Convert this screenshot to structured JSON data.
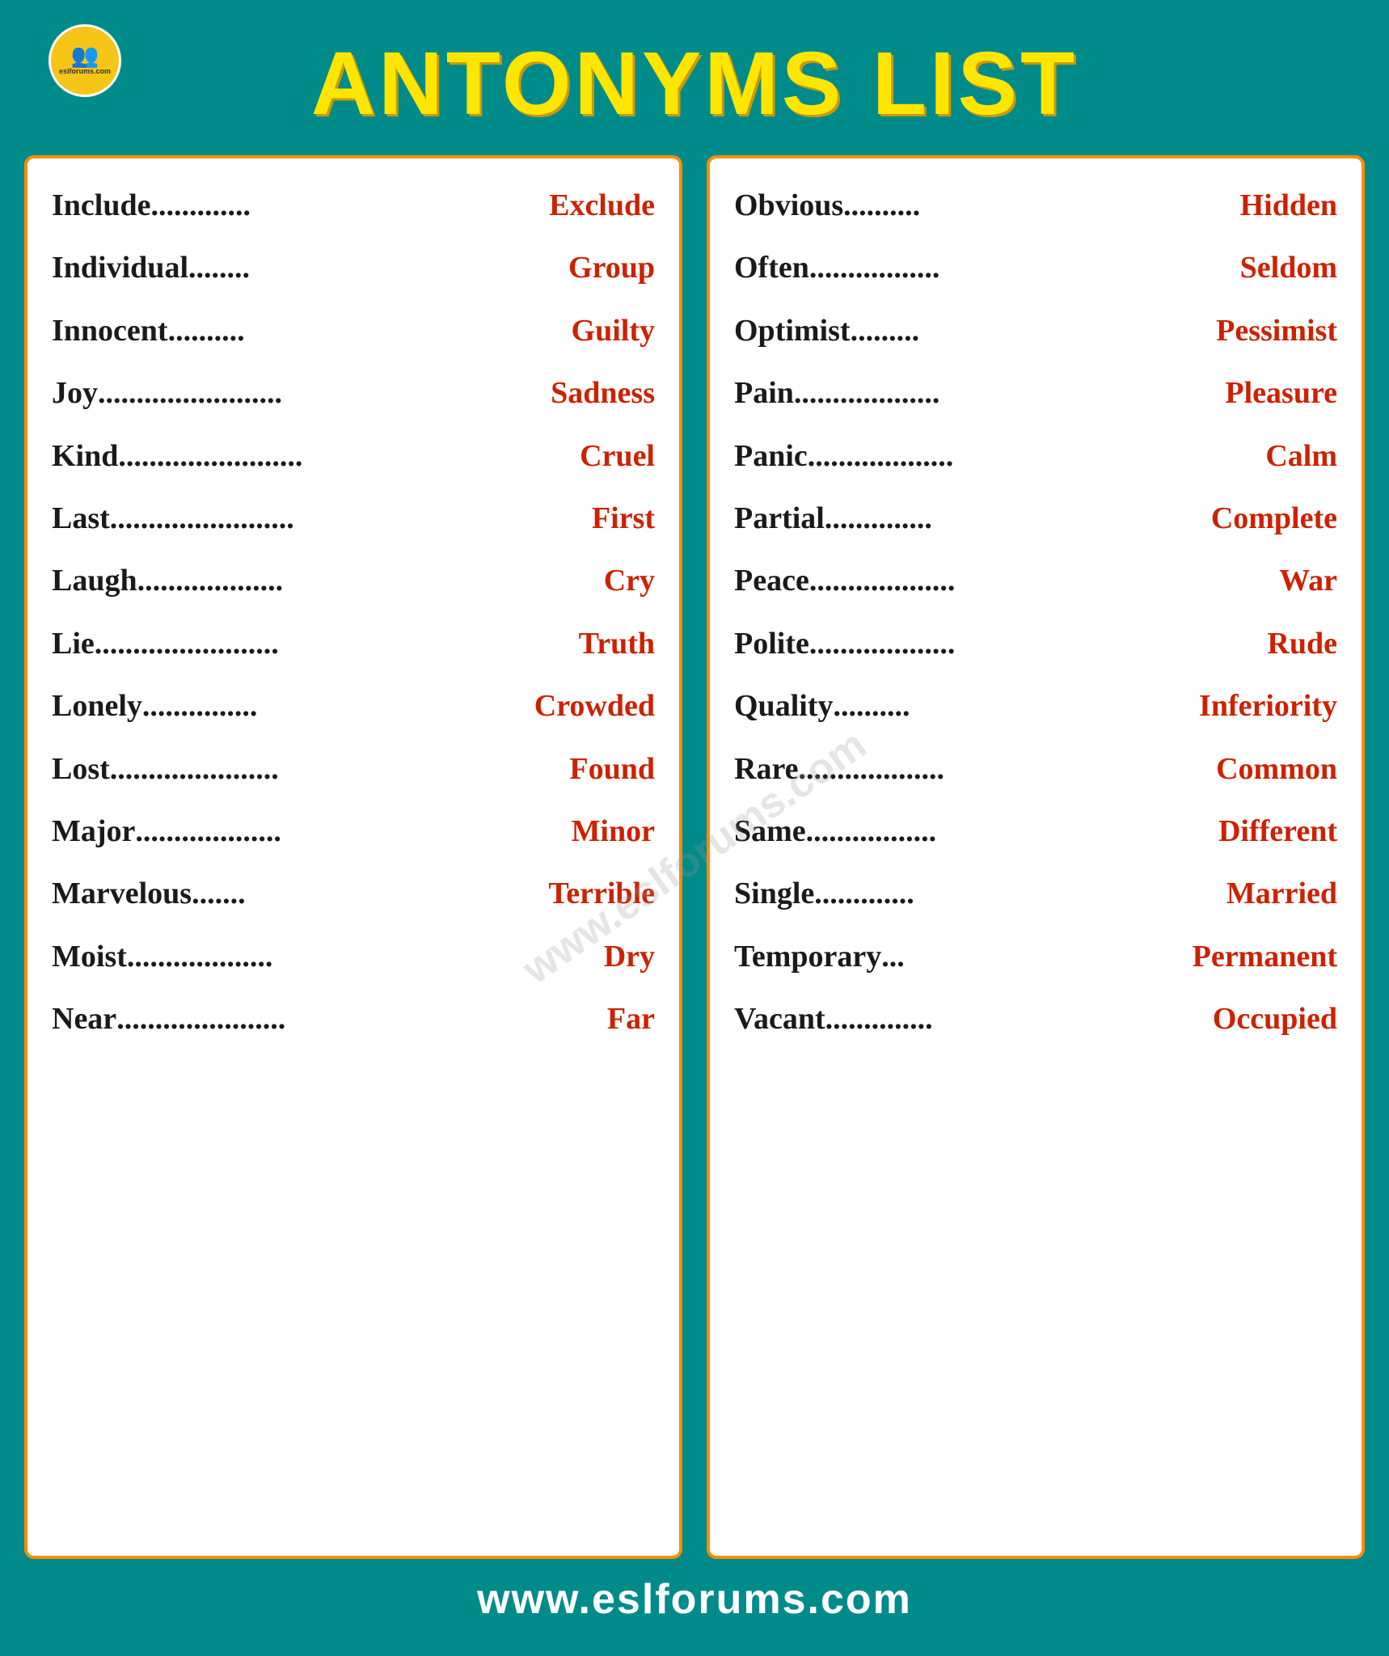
{
  "header": {
    "title": "ANTONYMS LIST",
    "logo_text": "eslforums.com"
  },
  "footer": {
    "url": "www.eslforums.com"
  },
  "watermark": "www.eslforums.com",
  "left_column": [
    {
      "word": "Include",
      "dots": ".............",
      "antonym": "Exclude"
    },
    {
      "word": "Individual",
      "dots": "........",
      "antonym": "Group"
    },
    {
      "word": "Innocent",
      "dots": "..........",
      "antonym": "Guilty"
    },
    {
      "word": "Joy",
      "dots": "........................",
      "antonym": "Sadness"
    },
    {
      "word": "Kind",
      "dots": "........................",
      "antonym": "Cruel"
    },
    {
      "word": "Last",
      "dots": "........................",
      "antonym": "First"
    },
    {
      "word": "Laugh",
      "dots": "...................",
      "antonym": "Cry"
    },
    {
      "word": "Lie",
      "dots": "........................",
      "antonym": "Truth"
    },
    {
      "word": "Lonely",
      "dots": "...............",
      "antonym": "Crowded"
    },
    {
      "word": "Lost",
      "dots": "......................",
      "antonym": "Found"
    },
    {
      "word": "Major",
      "dots": "...................",
      "antonym": "Minor"
    },
    {
      "word": "Marvelous",
      "dots": ".......",
      "antonym": "Terrible"
    },
    {
      "word": "Moist",
      "dots": "...................",
      "antonym": "Dry"
    },
    {
      "word": "Near",
      "dots": "......................",
      "antonym": "Far"
    }
  ],
  "right_column": [
    {
      "word": "Obvious",
      "dots": "..........",
      "antonym": "Hidden"
    },
    {
      "word": "Often",
      "dots": ".................",
      "antonym": "Seldom"
    },
    {
      "word": "Optimist",
      "dots": ".........",
      "antonym": "Pessimist"
    },
    {
      "word": "Pain",
      "dots": "...................",
      "antonym": "Pleasure"
    },
    {
      "word": "Panic",
      "dots": "...................",
      "antonym": "Calm"
    },
    {
      "word": "Partial",
      "dots": "..............",
      "antonym": "Complete"
    },
    {
      "word": "Peace",
      "dots": "...................",
      "antonym": "War"
    },
    {
      "word": "Polite",
      "dots": "...................",
      "antonym": "Rude"
    },
    {
      "word": "Quality",
      "dots": "..........",
      "antonym": "Inferiority"
    },
    {
      "word": "Rare",
      "dots": "...................",
      "antonym": "Common"
    },
    {
      "word": "Same",
      "dots": ".................",
      "antonym": "Different"
    },
    {
      "word": "Single",
      "dots": ".............",
      "antonym": "Married"
    },
    {
      "word": "Temporary",
      "dots": "...",
      "antonym": "Permanent"
    },
    {
      "word": "Vacant",
      "dots": "..............",
      "antonym": "Occupied"
    }
  ]
}
